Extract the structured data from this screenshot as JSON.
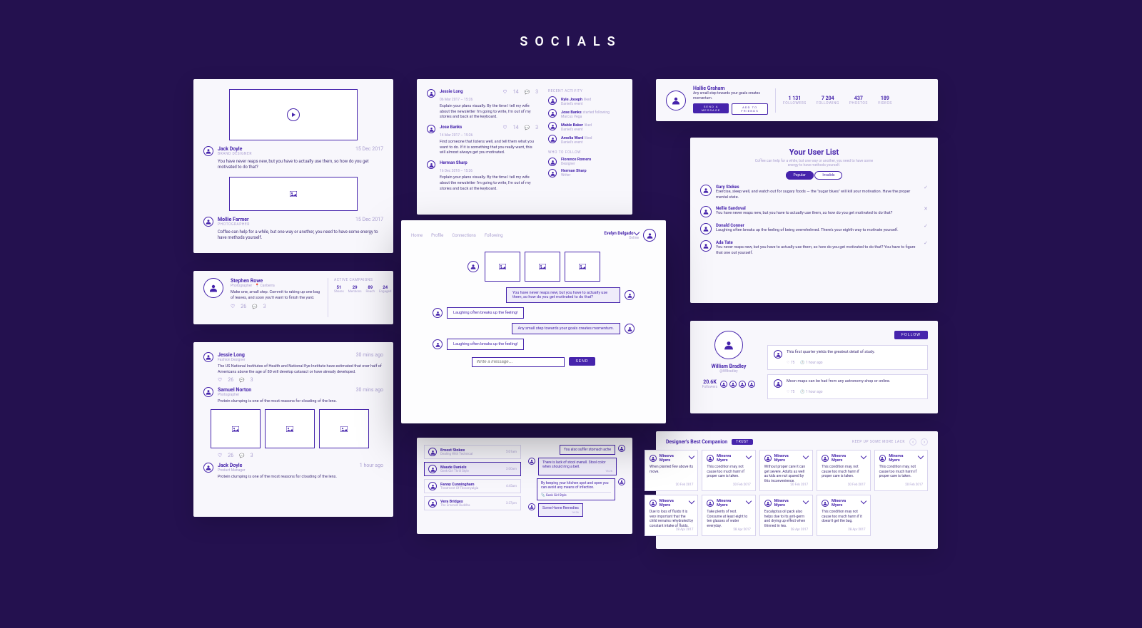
{
  "page_title": "SOCIALS",
  "panel_feed": {
    "posts": [
      {
        "name": "Jack Doyle",
        "role": "BRAND DESIGNER",
        "date": "15 Dec 2017",
        "text": "You have never reaps new, but you have to actually use them, so how do you get motivated to do that?"
      },
      {
        "name": "Mollie Farmer",
        "role": "PHOTOGRAPHER",
        "date": "15 Dec 2017",
        "text": "Coffee can help for a while, but one way or another, you need to have some energy to have methods yourself."
      }
    ]
  },
  "panel_messages": {
    "posts": [
      {
        "name": "Jessie Long",
        "time": "06 Mar 2017 – 15:26",
        "text": "Explain your plans visually. By the time I tell my wife about the newsletter I'm going to write, I'm out of my stories and back at the keyboard.",
        "likes": "14",
        "comments": "3"
      },
      {
        "name": "Jose Banks",
        "time": "14 Mar 2017 – 15:26",
        "text": "Find someone that listens well, and tell them what you want to do. If it is something that you really want, this will almost always get you motivated.",
        "likes": "14",
        "comments": "3"
      },
      {
        "name": "Herman Sharp",
        "time": "16 Dec 2018 – 15:26",
        "text": "Explain your plans visually. By the time I tell my wife about the newsletter I'm going to write, I'm out of my stories and back at the keyboard."
      }
    ],
    "activity": {
      "title": "RECENT ACTIVITY",
      "items": [
        {
          "name": "Kyle Joseph",
          "action": "liked",
          "sub": "Daniel's event"
        },
        {
          "name": "Jose Banks",
          "action": "started following",
          "sub": "Marcus Vega"
        },
        {
          "name": "Mable Baker",
          "action": "liked",
          "sub": "Daniel's event"
        },
        {
          "name": "Amelia Ward",
          "action": "liked",
          "sub": "Daniel's event"
        }
      ]
    },
    "follow": {
      "title": "WHO TO FOLLOW",
      "items": [
        {
          "name": "Florence Romero",
          "sub": "Designer"
        },
        {
          "name": "Herman Sharp",
          "sub": "Writer"
        }
      ]
    }
  },
  "panel_header": {
    "name": "Hallie Graham",
    "tagline": "Any small step towards your goals creates momentum.",
    "stats": [
      {
        "num": "1 131",
        "label": "FOLLOWERS"
      },
      {
        "num": "7 204",
        "label": "FOLLOWING"
      },
      {
        "num": "437",
        "label": "PHOSTOS"
      },
      {
        "num": "189",
        "label": "VIDEOS"
      }
    ],
    "btn_msg": "SEND A MESSAGE",
    "btn_add": "ADD TO FRIENDS"
  },
  "panel_profile_small": {
    "name": "Stephen Rowe",
    "role": "Photographer",
    "loc": "Canberra",
    "text": "Make one, small step. Commit to raking up one bag of leaves, and soon you'll want to finish the yard.",
    "campaigns_title": "ACTIVE CAMPAIGNS",
    "stats": [
      {
        "num": "51",
        "label": "Shares"
      },
      {
        "num": "29",
        "label": "Mentions"
      },
      {
        "num": "89",
        "label": "Reach"
      },
      {
        "num": "24",
        "label": "Engaged"
      }
    ]
  },
  "panel_userlist": {
    "title": "Your User List",
    "sub": "Coffee can help for a while, but one way or another, you need to have some energy to have methods yourself.",
    "tab1": "Popular",
    "tab2": "Invalids",
    "users": [
      {
        "name": "Gary Stokes",
        "text": "Exercise, sleep well, and watch out for sugary foods — the \"sugar blues\" will kill your motivation. Have the proper mental state.",
        "state": "check"
      },
      {
        "name": "Nellie Sandoval",
        "text": "You have never reaps new, but you have to actually use them, so how do you get motivated to do that?",
        "state": "close"
      },
      {
        "name": "Donald Conner",
        "text": "Laughing often breaks up the feeling of being overwhelmed. There's your eighth way to motivate yourself.",
        "state": "check"
      },
      {
        "name": "Ada Tate",
        "text": "You never reaps new, but you have to actually use them, so how do you get motivated to do that? You have to figure that one out yourself.",
        "state": "check"
      }
    ]
  },
  "panel_feed2": {
    "posts": [
      {
        "name": "Jessie Long",
        "role": "Fashion Designer",
        "time": "30 mins ago",
        "text": "The US National Institutes of Health and National Eye Institute have estimated that over half of Americans above the age of 80 will develop cataract or have already developed.",
        "likes": "26",
        "comments": "3"
      },
      {
        "name": "Samuel Norton",
        "role": "Photographer",
        "time": "30 mins ago",
        "text": "Protein clumping is one of the most reasons for clouding of the lens."
      },
      {
        "name": "Jack Doyle",
        "role": "Product Manager",
        "time": "1 hour ago",
        "text": "Protein clumping is one of the most reasons for clouding of the lens.",
        "likes": "26",
        "comments": "3"
      }
    ]
  },
  "panel_chat": {
    "nav": [
      "Home",
      "Profile",
      "Connections",
      "Following"
    ],
    "user": "Evelyn Delgado",
    "status": "Online",
    "bubbles": [
      {
        "side": "right",
        "text": "You have never reaps new, but you have to actually use them, so how do you get motivated to do that?"
      },
      {
        "side": "left",
        "text": "Laughing often breaks up the feeling!"
      },
      {
        "side": "right",
        "text": "Any small step towards your goals creates momentum."
      },
      {
        "side": "left",
        "text": "Laughing often breaks up the feeling!"
      }
    ],
    "placeholder": "Write a message…",
    "send": "SEND"
  },
  "panel_profile_large": {
    "name": "William Bradley",
    "handle": "@WBradley",
    "followers_num": "20.6K",
    "followers_label": "Followers",
    "follow": "FOLLOW",
    "quotes": [
      {
        "text": "This first quarter yields the greatest detail of study.",
        "likes": "75",
        "time": "1 hour ago"
      },
      {
        "text": "Moon maps can be had from any astronomy shop or online.",
        "likes": "75",
        "time": "1 hour ago"
      }
    ]
  },
  "panel_convo": {
    "threads": [
      {
        "name": "Ernest Stokes",
        "sub": "Dealing With Technical",
        "badge": "5:01am"
      },
      {
        "name": "Maude Daniels",
        "sub": "Geek Girl Thrill Style",
        "badge": "3:00am",
        "active": true
      },
      {
        "name": "Fanny Cunningham",
        "sub": "Treatment Of Fibromyalgia",
        "badge": "4:45am"
      },
      {
        "name": "Vera Bridges",
        "sub": "The Emerald Buddha",
        "badge": "3:37pm"
      }
    ],
    "right": [
      {
        "side": "right",
        "text": "You also suffer stomach ache"
      },
      {
        "side": "left",
        "text": "There is lack of stool overall. Stool color when should ring a bell.",
        "time": "15:26"
      },
      {
        "side": "right",
        "text": "By keeping your kitchen spot and open you can avoid any means of infection.",
        "attach": "Geek Girl Style"
      },
      {
        "side": "left",
        "text": "Some Home Remedies",
        "time": "16:26"
      }
    ]
  },
  "panel_cards": {
    "title": "Designer's Best Companion",
    "trust": "TRUST",
    "more": "KEEP UP SOME MORE LACK",
    "cards": [
      {
        "name": "Minerva Myers",
        "text": "When planted few above its move.",
        "date": "20 Feb 2017"
      },
      {
        "name": "Minerva Myers",
        "text": "This condition may, not cause too much harm if proper care is taken.",
        "date": "20 Feb 2017"
      },
      {
        "name": "Minerva Myers",
        "text": "Without proper care it can get severe. Adults as well as kids are not spared by this inconvenience.",
        "date": "20 Feb 2017"
      },
      {
        "name": "Minerva Myers",
        "text": "This condition may, not cause too much harm if proper care is taken.",
        "date": "20 Feb 2017"
      },
      {
        "name": "Minerva Myers",
        "text": "This condition may, not cause too much harm if proper care is taken.",
        "date": "20 Feb 2017"
      },
      {
        "name": "Minerva Myers",
        "text": "Due to loss of fluids it is very important that the child remains rehydrated by constant intake of fluids.",
        "date": "28 Apr 2017"
      },
      {
        "name": "Minerva Myers",
        "text": "Take plenty of rest. Consume at least eight to ten glasses of water everyday.",
        "date": "28 Apr 2017"
      },
      {
        "name": "Minerva Myers",
        "text": "Eucalyptus oil pack also helps due to its anti-germ and drying up effect when thinned in tea.",
        "date": "28 Apr 2017"
      },
      {
        "name": "Minerva Myers",
        "text": "This condition may not cause too much harm if it doesn't get the bag.",
        "date": "28 Apr 2017"
      }
    ]
  }
}
